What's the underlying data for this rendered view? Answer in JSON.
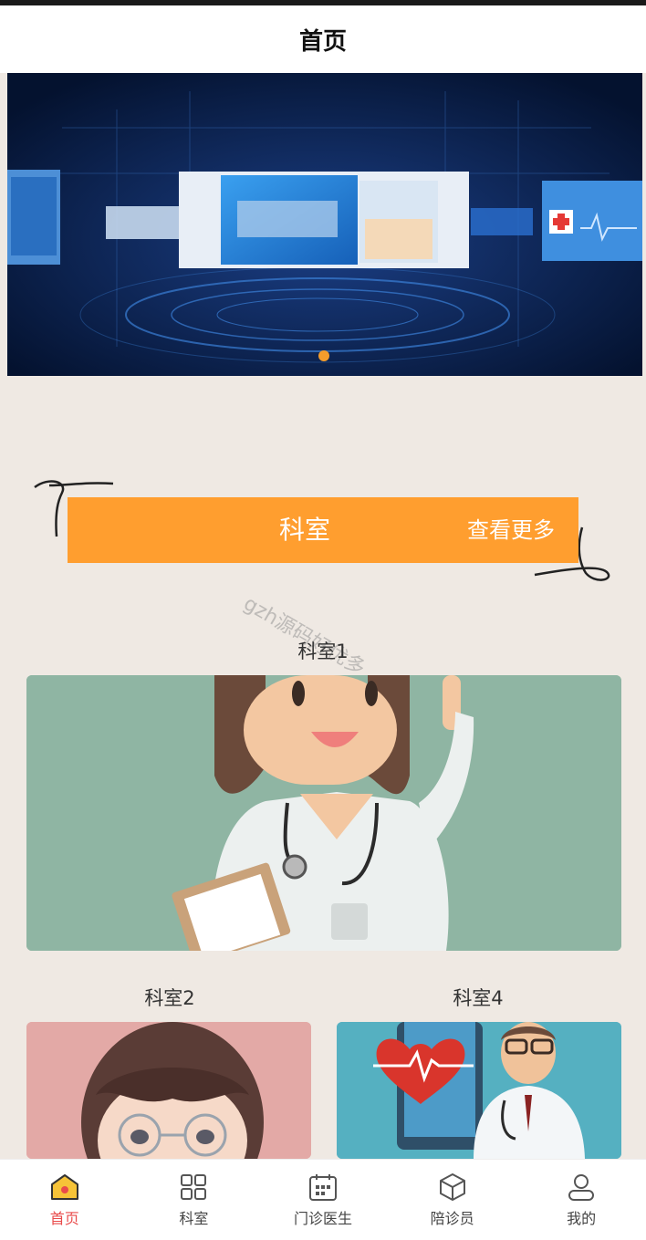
{
  "navbar": {
    "title": "首页"
  },
  "banner": {
    "image_label": "medical technology banner",
    "active_indicator_color": "#f39c2c"
  },
  "section": {
    "title": "科室",
    "view_more": "查看更多",
    "accent": "#ff9e2f"
  },
  "watermark": "gzh源码好优多",
  "departments": [
    {
      "label": "科室1",
      "image": "doctor-female-illustration"
    },
    {
      "label": "科室2",
      "image": "girl-with-glasses-illustration"
    },
    {
      "label": "科室4",
      "image": "doctor-with-heart-illustration"
    }
  ],
  "tabbar": {
    "items": [
      {
        "label": "首页",
        "icon": "home-icon",
        "active": true
      },
      {
        "label": "科室",
        "icon": "grid-icon",
        "active": false
      },
      {
        "label": "门诊医生",
        "icon": "calendar-icon",
        "active": false
      },
      {
        "label": "陪诊员",
        "icon": "box-icon",
        "active": false
      },
      {
        "label": "我的",
        "icon": "user-icon",
        "active": false
      }
    ],
    "active_color": "#e94b4b"
  }
}
